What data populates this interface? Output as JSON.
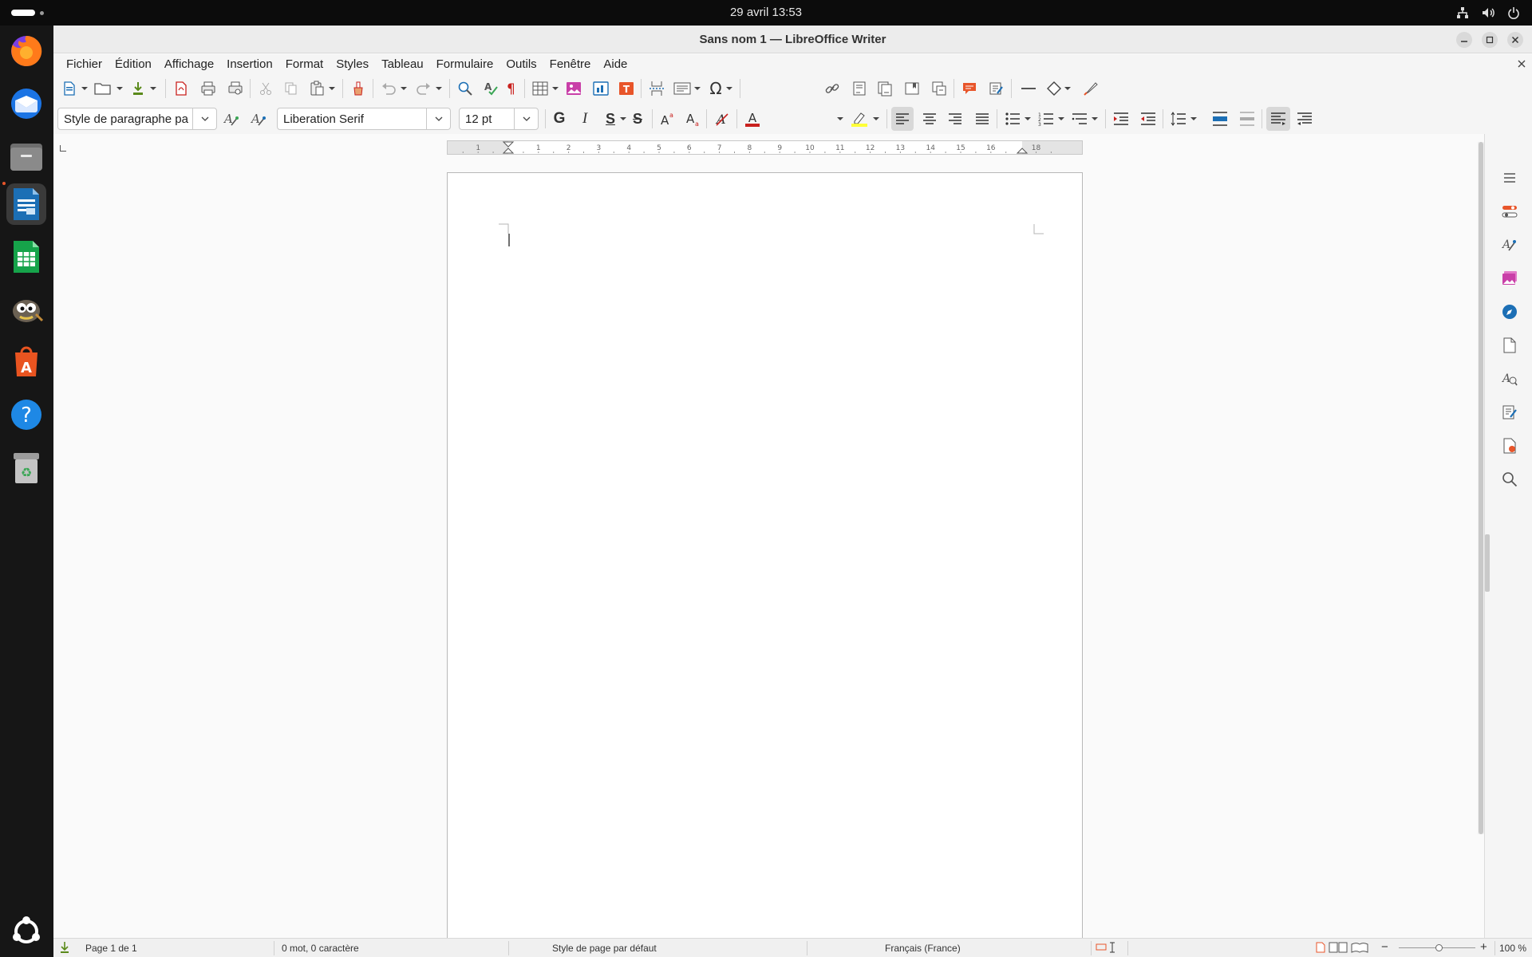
{
  "topbar": {
    "clock": "29 avril  13:53",
    "tray_icons": [
      "network-icon",
      "volume-icon",
      "power-icon"
    ]
  },
  "dock": {
    "apps": [
      "firefox-icon",
      "thunderbird-icon",
      "files-icon",
      "writer-icon",
      "calc-icon",
      "gimp-icon",
      "app-center-icon",
      "help-icon",
      "trash-icon"
    ],
    "active": "writer-icon",
    "show_apps_icon": "ubuntu-logo-icon"
  },
  "window": {
    "title": "Sans nom 1 — LibreOffice Writer"
  },
  "menubar": {
    "items": [
      "Fichier",
      "Édition",
      "Affichage",
      "Insertion",
      "Format",
      "Styles",
      "Tableau",
      "Formulaire",
      "Outils",
      "Fenêtre",
      "Aide"
    ]
  },
  "formatting": {
    "paragraph_style": "Style de paragraphe pa",
    "font_name": "Liberation Serif",
    "font_size": "12 pt",
    "bold_label": "G",
    "italic_label": "I",
    "underline_label": "S",
    "strike_label": "S"
  },
  "ruler": {
    "numbers": [
      "1",
      "1",
      "2",
      "3",
      "4",
      "5",
      "6",
      "7",
      "8",
      "9",
      "10",
      "11",
      "12",
      "13",
      "14",
      "15",
      "16",
      "18"
    ]
  },
  "statusbar": {
    "page": "Page 1 de 1",
    "words": "0 mot, 0 caractère",
    "page_style": "Style de page par défaut",
    "language": "Français (France)",
    "zoom": "100 %"
  },
  "colors": {
    "accent_red": "#c9211e",
    "highlight_yellow": "#ffff38",
    "writer_blue": "#1c6fb5",
    "calc_green": "#16a34a"
  }
}
